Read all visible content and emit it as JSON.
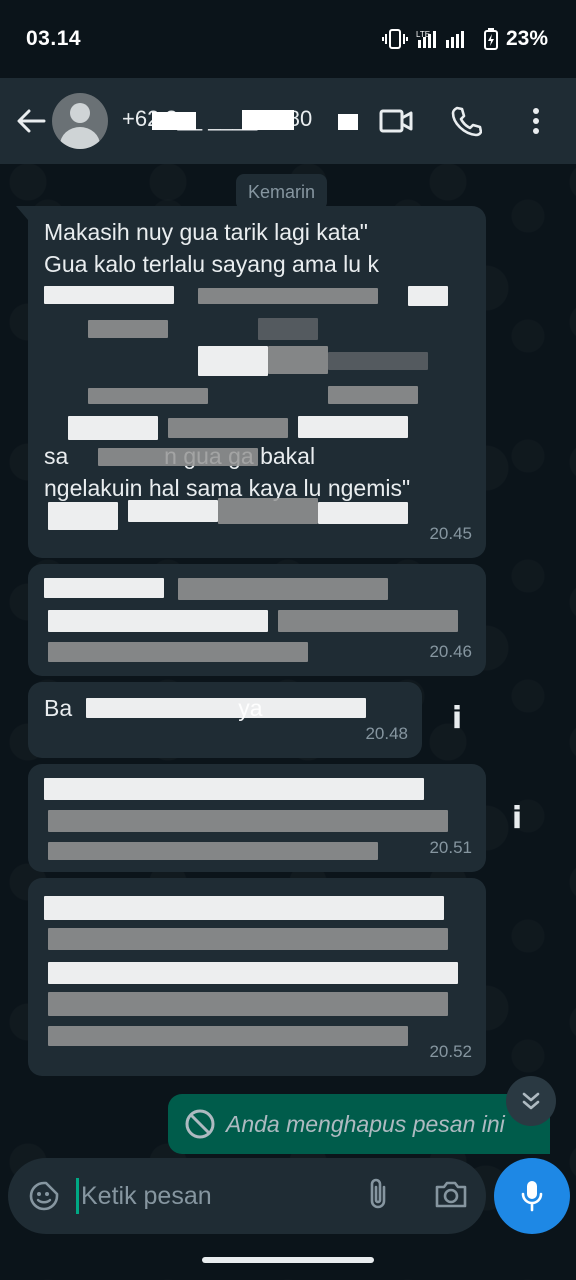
{
  "status_bar": {
    "time": "03.14",
    "network": "LTE",
    "battery": "23%"
  },
  "header": {
    "contact_name": "+62 8__ ____ 7180"
  },
  "chat": {
    "date_chip": "Kemarin",
    "messages": [
      {
        "text": "Makasih nuy gua tarik lagi kata\"\nGua kalo terlalu sayang ama lu k\n\n\n\n\n\nsa               n gua ga bakal\nngelakuin hal sama kaya lu ngemis\"\n",
        "time": "20.45"
      },
      {
        "text": "",
        "time": "20.46"
      },
      {
        "text": "Ba                          ya",
        "time": "20.48"
      },
      {
        "text": "",
        "time": "20.51"
      },
      {
        "text": "",
        "time": "20.52"
      }
    ],
    "deleted_message": "Anda menghapus pesan ini"
  },
  "composer": {
    "placeholder": "Ketik pesan"
  },
  "colors": {
    "background": "#0b141a",
    "bubble": "#1f2c34",
    "outgoing": "#005c4b",
    "mic": "#1e88e5"
  }
}
